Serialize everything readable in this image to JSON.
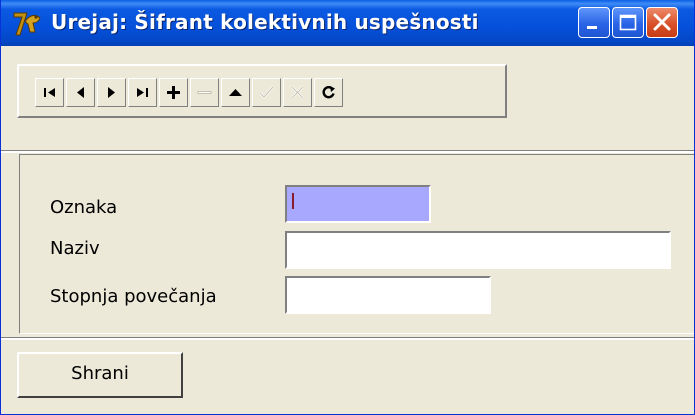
{
  "window": {
    "title": "Urejaj: Šifrant kolektivnih uspešnosti",
    "app_icon": "delphi-helmet-icon",
    "buttons": [
      "minimize-icon",
      "maximize-icon",
      "close-icon"
    ]
  },
  "toolbar": {
    "buttons": [
      {
        "name": "first-record-button",
        "icon": "first-icon",
        "enabled": true
      },
      {
        "name": "prior-record-button",
        "icon": "prior-icon",
        "enabled": true
      },
      {
        "name": "next-record-button",
        "icon": "next-icon",
        "enabled": true
      },
      {
        "name": "last-record-button",
        "icon": "last-icon",
        "enabled": true
      },
      {
        "name": "insert-button",
        "icon": "plus-icon",
        "enabled": true
      },
      {
        "name": "delete-button",
        "icon": "minus-icon",
        "enabled": false
      },
      {
        "name": "edit-button",
        "icon": "up-triangle-icon",
        "enabled": true
      },
      {
        "name": "post-button",
        "icon": "check-icon",
        "enabled": false
      },
      {
        "name": "cancel-button",
        "icon": "x-icon",
        "enabled": false
      },
      {
        "name": "refresh-button",
        "icon": "refresh-icon",
        "enabled": true
      }
    ]
  },
  "form": {
    "fields": [
      {
        "label": "Oznaka",
        "value": "",
        "focused": true
      },
      {
        "label": "Naziv",
        "value": ""
      },
      {
        "label": "Stopnja povečanja",
        "value": ""
      }
    ]
  },
  "actions": {
    "save_label": "Shrani"
  },
  "colors": {
    "titlebar": "#0550da",
    "face": "#ece9d8",
    "focus_field": "#a8a8ff",
    "close_button": "#d8512a"
  }
}
